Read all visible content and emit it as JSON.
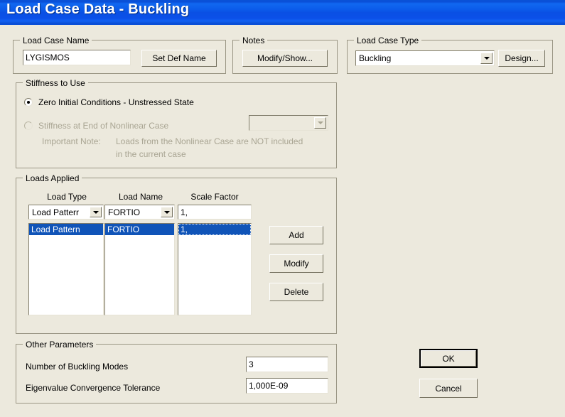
{
  "window": {
    "title": "Load Case Data - Buckling",
    "titlebar_color": "#0B55E0",
    "background_color": "#ECE9DD"
  },
  "load_case_name": {
    "group_title": "Load Case Name",
    "value": "LYGISMOS",
    "set_def_name_button": "Set Def Name"
  },
  "notes": {
    "group_title": "Notes",
    "modify_show_button": "Modify/Show..."
  },
  "load_case_type": {
    "group_title": "Load Case Type",
    "selected": "Buckling",
    "options": [
      "Buckling"
    ],
    "design_button": "Design..."
  },
  "stiffness": {
    "group_title": "Stiffness to Use",
    "option_zero_initial": "Zero Initial Conditions - Unstressed State",
    "option_nonlinear": "Stiffness at End of Nonlinear Case",
    "nonlinear_case_selected": "",
    "note_label": "Important Note:",
    "note_line1": "Loads from the Nonlinear Case are NOT included",
    "note_line2": "in the current case"
  },
  "loads_applied": {
    "group_title": "Loads Applied",
    "headers": {
      "load_type": "Load Type",
      "load_name": "Load Name",
      "scale_factor": "Scale Factor"
    },
    "editor": {
      "load_type": "Load Patterr",
      "load_name": "FORTIO",
      "scale_factor": "1,"
    },
    "rows": [
      {
        "load_type": "Load Pattern",
        "load_name": "FORTIO",
        "scale_factor": "1,"
      }
    ],
    "buttons": {
      "add": "Add",
      "modify": "Modify",
      "delete": "Delete"
    }
  },
  "other_parameters": {
    "group_title": "Other Parameters",
    "num_modes_label": "Number of Buckling Modes",
    "num_modes_value": "3",
    "tolerance_label": "Eigenvalue Convergence Tolerance",
    "tolerance_value": "1,000E-09"
  },
  "dialog_buttons": {
    "ok": "OK",
    "cancel": "Cancel"
  }
}
